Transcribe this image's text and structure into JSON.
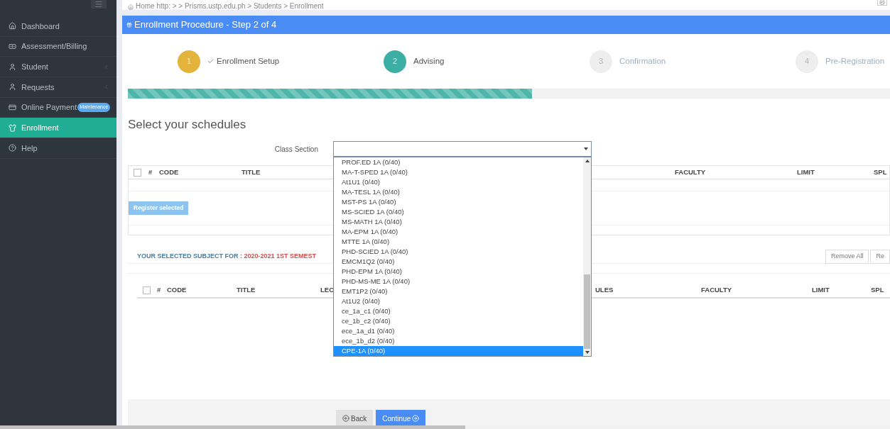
{
  "sidebar": {
    "items": [
      {
        "label": "Dashboard",
        "selected": false,
        "expandable": false
      },
      {
        "label": "Assessment/Billing",
        "selected": false,
        "expandable": false
      },
      {
        "label": "Student",
        "selected": false,
        "expandable": true
      },
      {
        "label": "Requests",
        "selected": false,
        "expandable": true
      },
      {
        "label": "Online Payment",
        "selected": false,
        "expandable": false,
        "badge": "Maintenance"
      },
      {
        "label": "Enrollment",
        "selected": true,
        "expandable": false
      },
      {
        "label": "Help",
        "selected": false,
        "expandable": false
      }
    ]
  },
  "breadcrumb": "Home http: >  > Prisms.ustp.edu.ph > Students > Enrollment",
  "panel": {
    "title": "Enrollment Procedure - Step 2 of 4",
    "steps": [
      {
        "number": "1",
        "label": "Enrollment Setup",
        "done": true,
        "selected": false
      },
      {
        "number": "2",
        "label": "Advising",
        "done": false,
        "selected": true
      },
      {
        "number": "3",
        "label": "Confirmation",
        "done": false,
        "selected": false
      },
      {
        "number": "4",
        "label": "Pre-Registration",
        "done": false,
        "selected": false
      }
    ],
    "progress": {
      "level": 0.53
    },
    "heading": "Select your schedules",
    "class_section": {
      "label": "Class Section",
      "expanded": true,
      "options": [
        {
          "label": "PROF.ED 1A (0/40)",
          "selected": false
        },
        {
          "label": "MA-T-SPED 1A (0/40)",
          "selected": false
        },
        {
          "label": "At1U1 (0/40)",
          "selected": false
        },
        {
          "label": "MA-TESL 1A (0/40)",
          "selected": false
        },
        {
          "label": "MST-PS 1A (0/40)",
          "selected": false
        },
        {
          "label": "MS-SCIED 1A (0/40)",
          "selected": false
        },
        {
          "label": "MS-MATH 1A (0/40)",
          "selected": false
        },
        {
          "label": "MA-EPM 1A (0/40)",
          "selected": false
        },
        {
          "label": "MTTE 1A (0/40)",
          "selected": false
        },
        {
          "label": "PHD-SCIED 1A (0/40)",
          "selected": false
        },
        {
          "label": "EMCM1Q2 (0/40)",
          "selected": false
        },
        {
          "label": "PHD-EPM 1A (0/40)",
          "selected": false
        },
        {
          "label": "PHD-MS-ME 1A (0/40)",
          "selected": false
        },
        {
          "label": "EMT1P2 (0/40)",
          "selected": false
        },
        {
          "label": "At1U2 (0/40)",
          "selected": false
        },
        {
          "label": "ce_1a_c1 (0/40)",
          "selected": false
        },
        {
          "label": "ce_1b_c2 (0/40)",
          "selected": false
        },
        {
          "label": "ece_1a_d1 (0/40)",
          "selected": false
        },
        {
          "label": "ece_1b_d2 (0/40)",
          "selected": false
        },
        {
          "label": "CPE-1A (0/40)",
          "selected": true
        }
      ]
    },
    "schedules_table": {
      "checked": false,
      "columns": [
        "#",
        "CODE",
        "TITLE",
        "FACULTY",
        "LIMIT",
        "SPL"
      ]
    },
    "register_button": "Register selected",
    "selected_heading": {
      "text": "YOUR SELECTED SUBJECT FOR : ",
      "term": "2020-2021 1ST SEMEST"
    },
    "selected_buttons": [
      "Remove All",
      "Re"
    ],
    "selected_table": {
      "checked": false,
      "columns": [
        "#",
        "CODE",
        "TITLE",
        "LEC",
        "ULES",
        "FACULTY",
        "LIMIT",
        "SPL"
      ]
    },
    "footer_buttons": [
      {
        "label": "Back",
        "kind": "back"
      },
      {
        "label": "Continue",
        "kind": "continue"
      }
    ]
  }
}
